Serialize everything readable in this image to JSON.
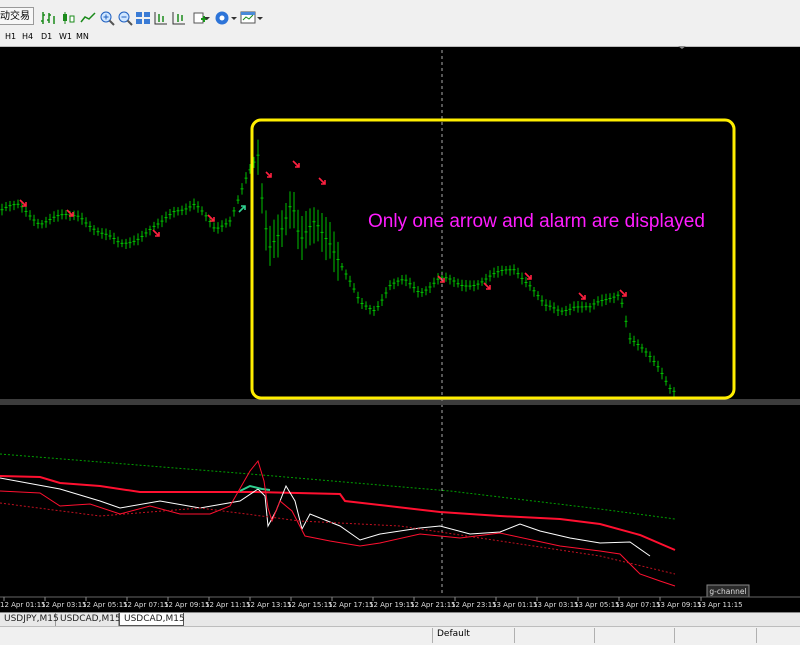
{
  "toolbar": {
    "auto_trading_label": "动交易"
  },
  "timeframes": [
    "H1",
    "H4",
    "D1",
    "W1",
    "MN"
  ],
  "annotation": {
    "text": "Only one arrow and alarm are displayed",
    "color": "#ff1dff",
    "box_color": "#ffee00"
  },
  "indicator_label": "g-channel",
  "time_labels": [
    "12 Apr 01:15",
    "12 Apr 03:15",
    "12 Apr 05:15",
    "12 Apr 07:15",
    "12 Apr 09:15",
    "12 Apr 11:15",
    "12 Apr 13:15",
    "12 Apr 15:15",
    "12 Apr 17:15",
    "12 Apr 19:15",
    "12 Apr 21:15",
    "12 Apr 23:15",
    "13 Apr 01:15",
    "13 Apr 03:15",
    "13 Apr 05:15",
    "13 Apr 07:15",
    "13 Apr 09:15",
    "13 Apr 11:15"
  ],
  "tabs": [
    "USDJPY,M15",
    "USDCAD,M15",
    "USDCAD,M15"
  ],
  "status": {
    "profile": "Default"
  },
  "colors": {
    "candle": "#00c000",
    "sell_arrow": "#ff2040",
    "buy_arrow": "#30d090",
    "red_line": "#ff1030",
    "white_line": "#ffffff",
    "green_dots": "#00a000",
    "background": "#000000"
  }
}
